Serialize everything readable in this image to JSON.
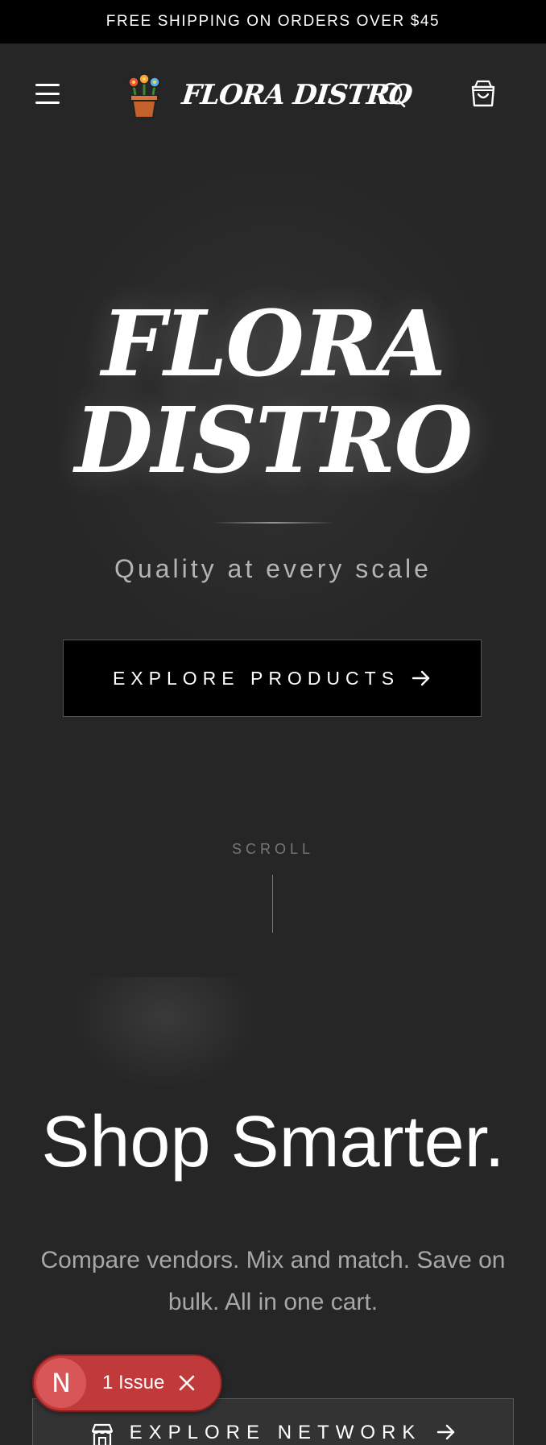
{
  "announcement": {
    "text": "FREE SHIPPING ON ORDERS OVER $45"
  },
  "header": {
    "logo_text": "FLORA DISTRO",
    "icons": [
      "menu-icon",
      "flower-pot-icon",
      "search-icon",
      "shopping-bag-icon"
    ]
  },
  "hero": {
    "title_line1": "FLORA",
    "title_line2": "DISTRO",
    "tagline": "Quality at every scale",
    "cta_label": "EXPLORE PRODUCTS",
    "scroll_label": "SCROLL"
  },
  "section2": {
    "title": "Shop Smarter.",
    "description": "Compare vendors. Mix and match. Save on bulk. All in one cart.",
    "cta_label": "EXPLORE NETWORK"
  },
  "issue_overlay": {
    "badge_letter": "N",
    "label": "1 Issue"
  },
  "colors": {
    "background": "#262626",
    "announce_bg": "#000000",
    "issue_red": "#c0393b"
  }
}
